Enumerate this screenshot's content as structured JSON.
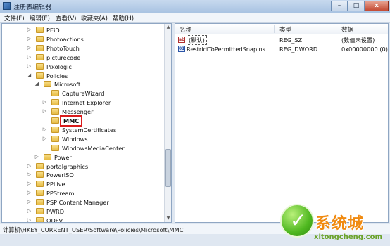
{
  "window": {
    "title": "注册表编辑器",
    "minimize": "–",
    "maximize": "□",
    "close": "x"
  },
  "menu": [
    {
      "label": "文件(F)"
    },
    {
      "label": "编辑(E)"
    },
    {
      "label": "查看(V)"
    },
    {
      "label": "收藏夹(A)"
    },
    {
      "label": "帮助(H)"
    }
  ],
  "tree": [
    {
      "label": "PEiD",
      "expander": "▷"
    },
    {
      "label": "Photoactions",
      "expander": "▷"
    },
    {
      "label": "PhotoTouch",
      "expander": "▷"
    },
    {
      "label": "picturecode",
      "expander": "▷"
    },
    {
      "label": "Pixologic",
      "expander": "▷"
    },
    {
      "label": "Policies",
      "expander": "◢"
    },
    {
      "label": "Microsoft",
      "expander": "◢"
    },
    {
      "label": "CaptureWizard",
      "expander": ""
    },
    {
      "label": "Internet Explorer",
      "expander": "▷"
    },
    {
      "label": "Messenger",
      "expander": "▷"
    },
    {
      "label": "MMC",
      "expander": "",
      "selected": true
    },
    {
      "label": "SystemCertificates",
      "expander": "▷"
    },
    {
      "label": "Windows",
      "expander": "▷"
    },
    {
      "label": "WindowsMediaCenter",
      "expander": ""
    },
    {
      "label": "Power",
      "expander": "▷"
    },
    {
      "label": "portalgraphics",
      "expander": "▷"
    },
    {
      "label": "PowerISO",
      "expander": "▷"
    },
    {
      "label": "PPLive",
      "expander": "▷"
    },
    {
      "label": "PPStream",
      "expander": "▷"
    },
    {
      "label": "PSP Content Manager",
      "expander": "▷"
    },
    {
      "label": "PWRD",
      "expander": "▷"
    },
    {
      "label": "QDFV",
      "expander": "▷"
    }
  ],
  "list": {
    "headers": {
      "name": "名称",
      "type": "类型",
      "data": "数据"
    },
    "rows": [
      {
        "icon": "string-value-icon",
        "icon_text": "ab",
        "name": "(默认)",
        "type": "REG_SZ",
        "data": "(数值未设置)"
      },
      {
        "icon": "binary-value-icon",
        "icon_text": "01",
        "name": "RestrictToPermittedSnapins",
        "type": "REG_DWORD",
        "data": "0x00000000 (0)"
      }
    ]
  },
  "statusbar": {
    "path": "计算机\\HKEY_CURRENT_USER\\Software\\Policies\\Microsoft\\MMC"
  },
  "watermark": {
    "text": "系统城",
    "url": "xitongcheng.com"
  }
}
